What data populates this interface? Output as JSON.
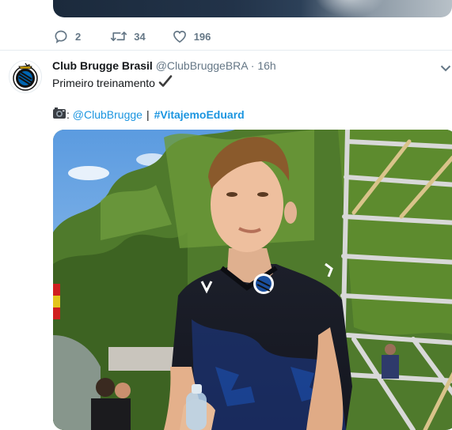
{
  "previous_tweet": {
    "reply_count": "2",
    "retweet_count": "34",
    "like_count": "196"
  },
  "tweet": {
    "display_name": "Club Brugge Brasil",
    "handle": "@ClubBruggeBRA",
    "separator": "·",
    "time": "16h",
    "text": "Primeiro treinamento",
    "credit_mention": "@ClubBrugge",
    "credit_separator": "|",
    "hashtag": "#VitajemoEduard"
  },
  "colors": {
    "link": "#1b95e0",
    "secondary_text": "#657786",
    "club_blue": "#0066b3"
  },
  "icons": {
    "reply": "reply-icon",
    "retweet": "retweet-icon",
    "like": "heart-icon",
    "caret": "chevron-down-icon",
    "check": "checkmark-icon",
    "camera": "camera-emoji-icon"
  }
}
